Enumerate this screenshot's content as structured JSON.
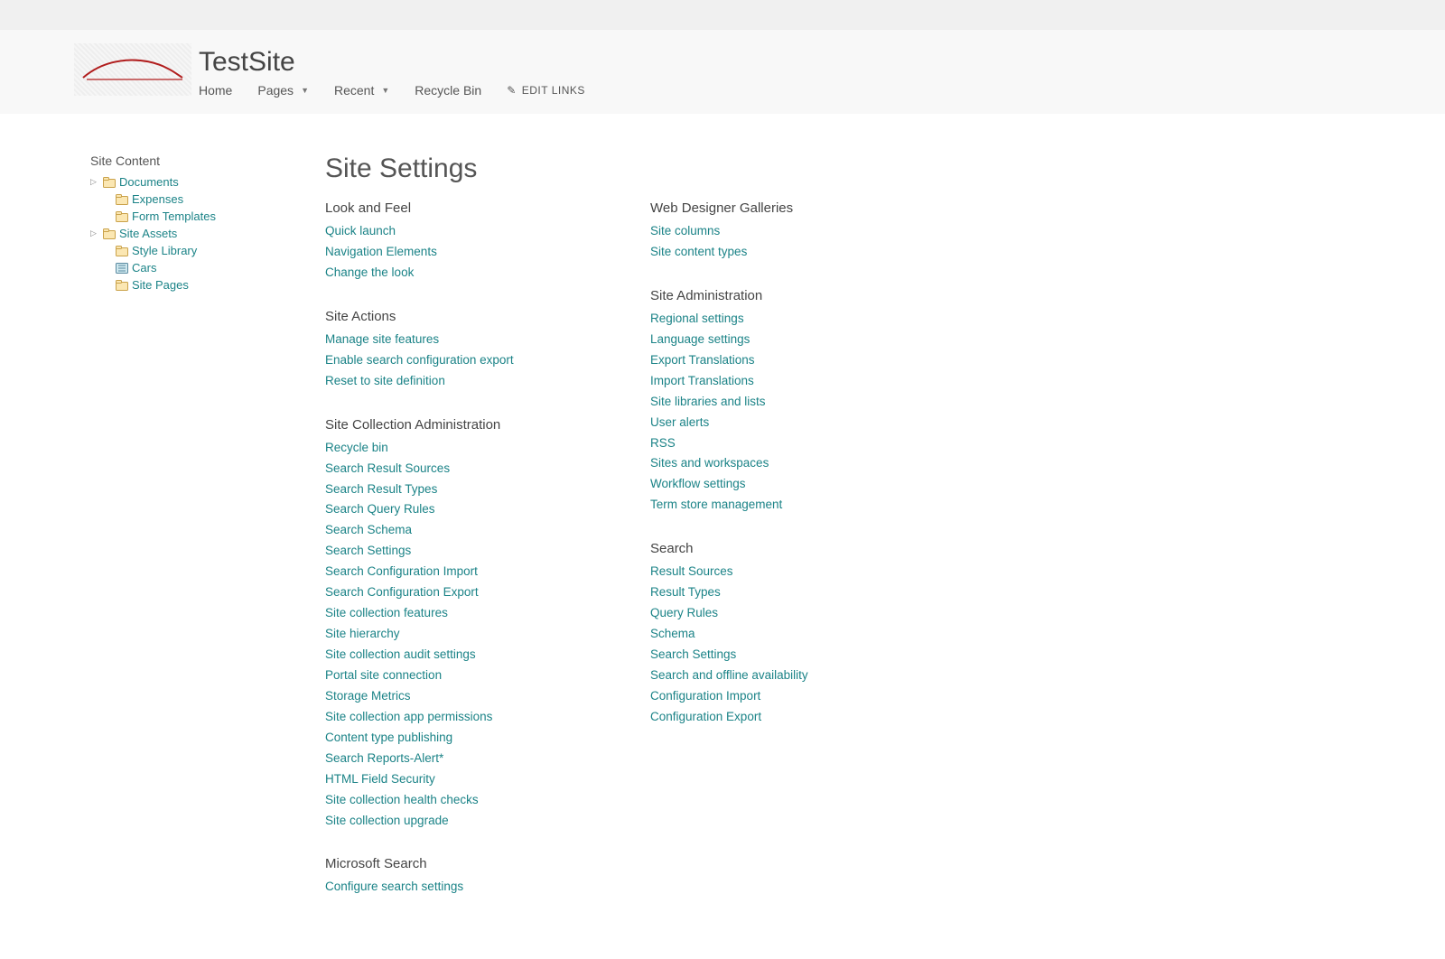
{
  "header": {
    "site_title": "TestSite",
    "nav": {
      "home": "Home",
      "pages": "Pages",
      "recent": "Recent",
      "recycle": "Recycle Bin",
      "edit_links": "EDIT LINKS"
    }
  },
  "left_nav": {
    "title": "Site Content",
    "items": [
      {
        "label": "Documents",
        "icon": "folder",
        "expandable": true,
        "level": 1
      },
      {
        "label": "Expenses",
        "icon": "folder",
        "expandable": false,
        "level": 2
      },
      {
        "label": "Form Templates",
        "icon": "folder",
        "expandable": false,
        "level": 2
      },
      {
        "label": "Site Assets",
        "icon": "folder",
        "expandable": true,
        "level": 1
      },
      {
        "label": "Style Library",
        "icon": "folder",
        "expandable": false,
        "level": 2
      },
      {
        "label": "Cars",
        "icon": "list",
        "expandable": false,
        "level": 2
      },
      {
        "label": "Site Pages",
        "icon": "folder",
        "expandable": false,
        "level": 2
      }
    ]
  },
  "main": {
    "page_title": "Site Settings",
    "columns": [
      [
        {
          "heading": "Look and Feel",
          "links": [
            "Quick launch",
            "Navigation Elements",
            "Change the look"
          ]
        },
        {
          "heading": "Site Actions",
          "links": [
            "Manage site features",
            "Enable search configuration export",
            "Reset to site definition"
          ]
        },
        {
          "heading": "Site Collection Administration",
          "links": [
            "Recycle bin",
            "Search Result Sources",
            "Search Result Types",
            "Search Query Rules",
            "Search Schema",
            "Search Settings",
            "Search Configuration Import",
            "Search Configuration Export",
            "Site collection features",
            "Site hierarchy",
            "Site collection audit settings",
            "Portal site connection",
            "Storage Metrics",
            "Site collection app permissions",
            "Content type publishing",
            "Search Reports-Alert*",
            "HTML Field Security",
            "Site collection health checks",
            "Site collection upgrade"
          ]
        },
        {
          "heading": "Microsoft Search",
          "links": [
            "Configure search settings"
          ]
        }
      ],
      [
        {
          "heading": "Web Designer Galleries",
          "links": [
            "Site columns",
            "Site content types"
          ]
        },
        {
          "heading": "Site Administration",
          "links": [
            "Regional settings",
            "Language settings",
            "Export Translations",
            "Import Translations",
            "Site libraries and lists",
            "User alerts",
            "RSS",
            "Sites and workspaces",
            "Workflow settings",
            "Term store management"
          ]
        },
        {
          "heading": "Search",
          "links": [
            "Result Sources",
            "Result Types",
            "Query Rules",
            "Schema",
            "Search Settings",
            "Search and offline availability",
            "Configuration Import",
            "Configuration Export"
          ]
        }
      ]
    ]
  }
}
